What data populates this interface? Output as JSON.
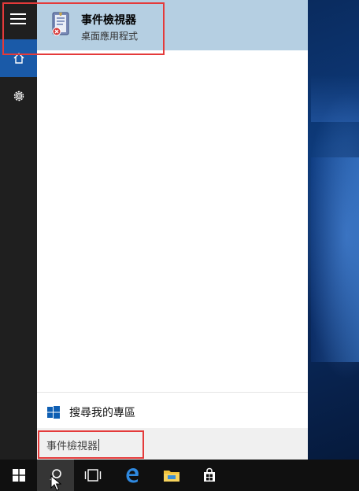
{
  "start_menu": {
    "best_match": {
      "title": "事件檢視器",
      "subtitle": "桌面應用程式",
      "icon": "event-viewer-icon"
    },
    "my_stuff_label": "搜尋我的專區",
    "search": {
      "value": "事件檢視器"
    },
    "rail_icons": [
      "hamburger-icon",
      "home-icon",
      "gear-icon"
    ]
  },
  "taskbar": {
    "icons": [
      "windows-logo-icon",
      "search-icon",
      "task-view-icon",
      "edge-icon",
      "file-explorer-icon",
      "store-icon"
    ]
  },
  "colors": {
    "accent": "#1a5aa8",
    "selection": "#b5cfe2",
    "annotation": "#e43a3a",
    "rail": "#1f1f1f",
    "taskbar": "#101010"
  }
}
